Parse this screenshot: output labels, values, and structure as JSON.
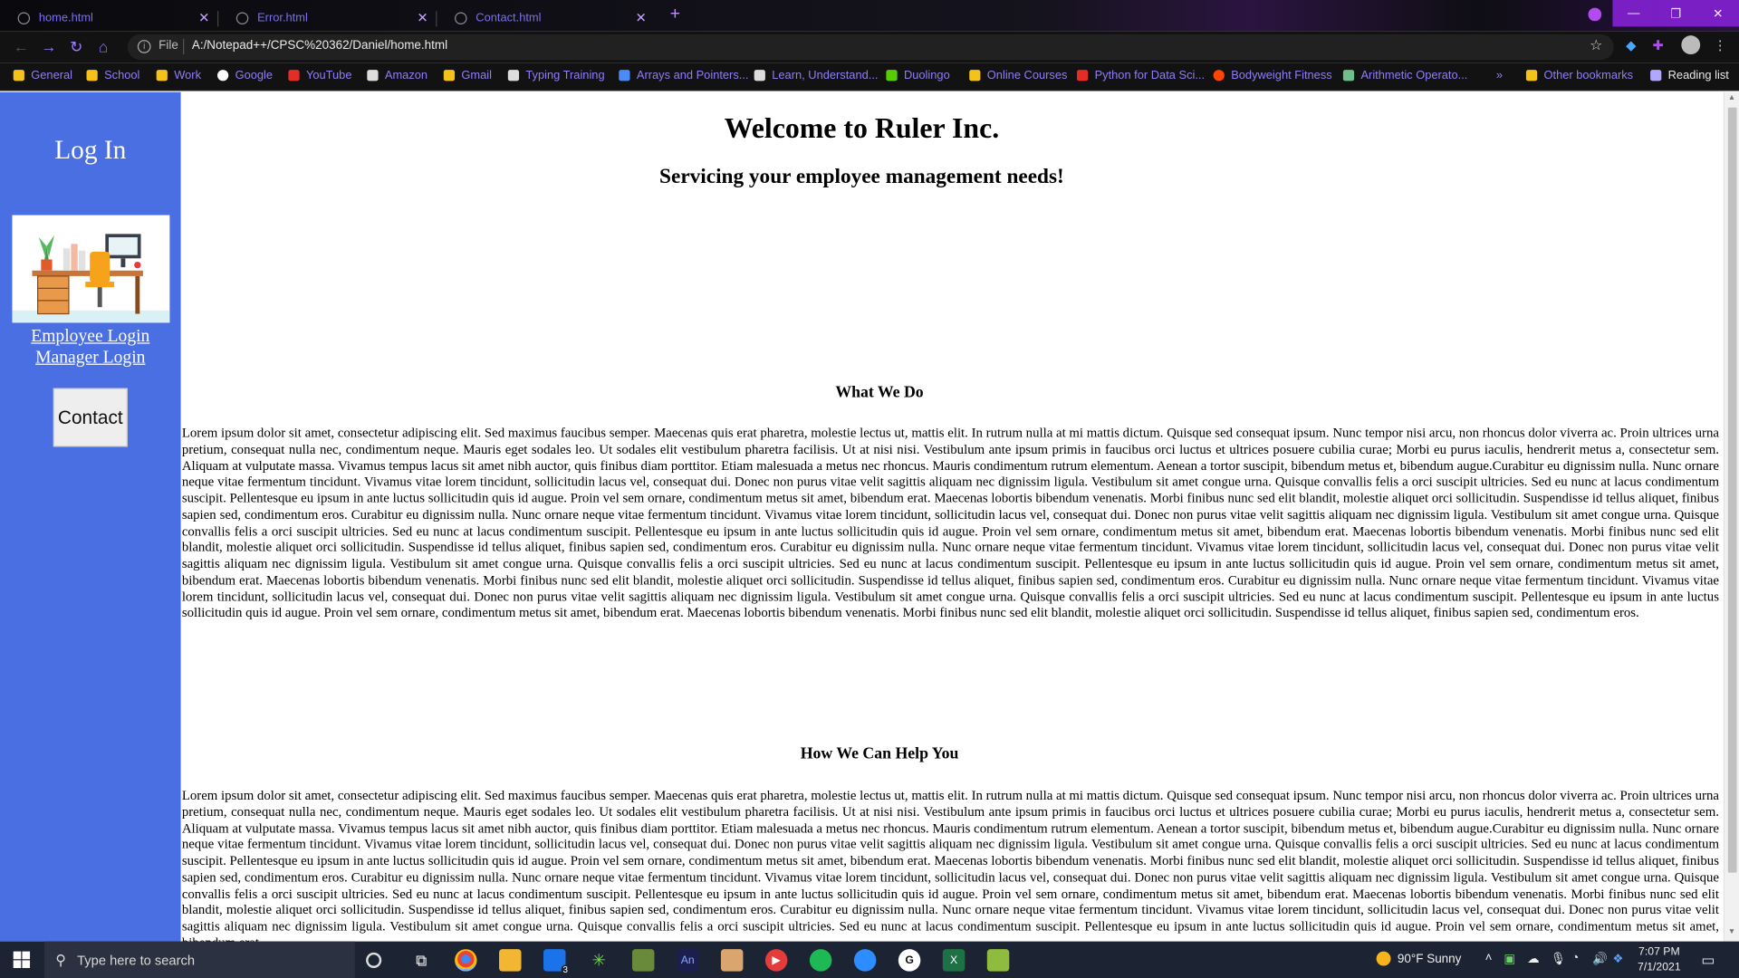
{
  "browser": {
    "tabs": [
      {
        "title": "home.html",
        "active": true
      },
      {
        "title": "Error.html",
        "active": false
      },
      {
        "title": "Contact.html",
        "active": false
      }
    ],
    "new_tab_icon": "+",
    "address": {
      "security_label": "File",
      "url": "A:/Notepad++/CPSC%20362/Daniel/home.html"
    },
    "bookmarks": [
      {
        "label": "General",
        "icon": "folder"
      },
      {
        "label": "School",
        "icon": "folder"
      },
      {
        "label": "Work",
        "icon": "folder"
      },
      {
        "label": "Google",
        "icon": "google"
      },
      {
        "label": "YouTube",
        "icon": "youtube"
      },
      {
        "label": "Amazon",
        "icon": "amazon"
      },
      {
        "label": "Gmail",
        "icon": "folder"
      },
      {
        "label": "Typing Training",
        "icon": "doc"
      },
      {
        "label": "Arrays and Pointers...",
        "icon": "c"
      },
      {
        "label": "Learn, Understand...",
        "icon": "grid"
      },
      {
        "label": "Duolingo",
        "icon": "duolingo"
      },
      {
        "label": "Online Courses",
        "icon": "folder"
      },
      {
        "label": "Python for Data Sci...",
        "icon": "udemy"
      },
      {
        "label": "Bodyweight Fitness",
        "icon": "reddit"
      },
      {
        "label": "Arithmetic Operato...",
        "icon": "site"
      }
    ],
    "more_bookmarks": "»",
    "other_bookmarks": "Other bookmarks",
    "reading_list": "Reading list"
  },
  "sidebar": {
    "title": "Log In",
    "employee_login": "Employee Login",
    "manager_login": "Manager Login",
    "contact_button": "Contact"
  },
  "main": {
    "heading": "Welcome to Ruler Inc.",
    "subheading": "Servicing your employee management needs!",
    "section1_title": "What We Do",
    "section1_text": "Lorem ipsum dolor sit amet, consectetur adipiscing elit. Sed maximus faucibus semper. Maecenas quis erat pharetra, molestie lectus ut, mattis elit. In rutrum nulla at mi mattis dictum. Quisque sed consequat ipsum. Nunc tempor nisi arcu, non rhoncus dolor viverra ac. Proin ultrices urna pretium, consequat nulla nec, condimentum neque. Mauris eget sodales leo. Ut sodales elit vestibulum pharetra facilisis. Ut at nisi nisi. Vestibulum ante ipsum primis in faucibus orci luctus et ultrices posuere cubilia curae; Morbi eu purus iaculis, hendrerit metus a, consectetur sem. Aliquam at vulputate massa. Vivamus tempus lacus sit amet nibh auctor, quis finibus diam porttitor. Etiam malesuada a metus nec rhoncus. Mauris condimentum rutrum elementum. Aenean a tortor suscipit, bibendum metus et, bibendum augue.Curabitur eu dignissim nulla. Nunc ornare neque vitae fermentum tincidunt. Vivamus vitae lorem tincidunt, sollicitudin lacus vel, consequat dui. Donec non purus vitae velit sagittis aliquam nec dignissim ligula. Vestibulum sit amet congue urna. Quisque convallis felis a orci suscipit ultricies. Sed eu nunc at lacus condimentum suscipit. Pellentesque eu ipsum in ante luctus sollicitudin quis id augue. Proin vel sem ornare, condimentum metus sit amet, bibendum erat. Maecenas lobortis bibendum venenatis. Morbi finibus nunc sed elit blandit, molestie aliquet orci sollicitudin. Suspendisse id tellus aliquet, finibus sapien sed, condimentum eros. Curabitur eu dignissim nulla. Nunc ornare neque vitae fermentum tincidunt. Vivamus vitae lorem tincidunt, sollicitudin lacus vel, consequat dui. Donec non purus vitae velit sagittis aliquam nec dignissim ligula. Vestibulum sit amet congue urna. Quisque convallis felis a orci suscipit ultricies. Sed eu nunc at lacus condimentum suscipit. Pellentesque eu ipsum in ante luctus sollicitudin quis id augue. Proin vel sem ornare, condimentum metus sit amet, bibendum erat. Maecenas lobortis bibendum venenatis. Morbi finibus nunc sed elit blandit, molestie aliquet orci sollicitudin. Suspendisse id tellus aliquet, finibus sapien sed, condimentum eros. Curabitur eu dignissim nulla. Nunc ornare neque vitae fermentum tincidunt. Vivamus vitae lorem tincidunt, sollicitudin lacus vel, consequat dui. Donec non purus vitae velit sagittis aliquam nec dignissim ligula. Vestibulum sit amet congue urna. Quisque convallis felis a orci suscipit ultricies. Sed eu nunc at lacus condimentum suscipit. Pellentesque eu ipsum in ante luctus sollicitudin quis id augue. Proin vel sem ornare, condimentum metus sit amet, bibendum erat. Maecenas lobortis bibendum venenatis. Morbi finibus nunc sed elit blandit, molestie aliquet orci sollicitudin. Suspendisse id tellus aliquet, finibus sapien sed, condimentum eros. Curabitur eu dignissim nulla. Nunc ornare neque vitae fermentum tincidunt. Vivamus vitae lorem tincidunt, sollicitudin lacus vel, consequat dui. Donec non purus vitae velit sagittis aliquam nec dignissim ligula. Vestibulum sit amet congue urna. Quisque convallis felis a orci suscipit ultricies. Sed eu nunc at lacus condimentum suscipit. Pellentesque eu ipsum in ante luctus sollicitudin quis id augue. Proin vel sem ornare, condimentum metus sit amet, bibendum erat. Maecenas lobortis bibendum venenatis. Morbi finibus nunc sed elit blandit, molestie aliquet orci sollicitudin. Suspendisse id tellus aliquet, finibus sapien sed, condimentum eros.",
    "section2_title": "How We Can Help You",
    "section2_text": "Lorem ipsum dolor sit amet, consectetur adipiscing elit. Sed maximus faucibus semper. Maecenas quis erat pharetra, molestie lectus ut, mattis elit. In rutrum nulla at mi mattis dictum. Quisque sed consequat ipsum. Nunc tempor nisi arcu, non rhoncus dolor viverra ac. Proin ultrices urna pretium, consequat nulla nec, condimentum neque. Mauris eget sodales leo. Ut sodales elit vestibulum pharetra facilisis. Ut at nisi nisi. Vestibulum ante ipsum primis in faucibus orci luctus et ultrices posuere cubilia curae; Morbi eu purus iaculis, hendrerit metus a, consectetur sem. Aliquam at vulputate massa. Vivamus tempus lacus sit amet nibh auctor, quis finibus diam porttitor. Etiam malesuada a metus nec rhoncus. Mauris condimentum rutrum elementum. Aenean a tortor suscipit, bibendum metus et, bibendum augue.Curabitur eu dignissim nulla. Nunc ornare neque vitae fermentum tincidunt. Vivamus vitae lorem tincidunt, sollicitudin lacus vel, consequat dui. Donec non purus vitae velit sagittis aliquam nec dignissim ligula. Vestibulum sit amet congue urna. Quisque convallis felis a orci suscipit ultricies. Sed eu nunc at lacus condimentum suscipit. Pellentesque eu ipsum in ante luctus sollicitudin quis id augue. Proin vel sem ornare, condimentum metus sit amet, bibendum erat. Maecenas lobortis bibendum venenatis. Morbi finibus nunc sed elit blandit, molestie aliquet orci sollicitudin. Suspendisse id tellus aliquet, finibus sapien sed, condimentum eros. Curabitur eu dignissim nulla. Nunc ornare neque vitae fermentum tincidunt. Vivamus vitae lorem tincidunt, sollicitudin lacus vel, consequat dui. Donec non purus vitae velit sagittis aliquam nec dignissim ligula. Vestibulum sit amet congue urna. Quisque convallis felis a orci suscipit ultricies. Sed eu nunc at lacus condimentum suscipit. Pellentesque eu ipsum in ante luctus sollicitudin quis id augue. Proin vel sem ornare, condimentum metus sit amet, bibendum erat. Maecenas lobortis bibendum venenatis. Morbi finibus nunc sed elit blandit, molestie aliquet orci sollicitudin. Suspendisse id tellus aliquet, finibus sapien sed, condimentum eros. Curabitur eu dignissim nulla. Nunc ornare neque vitae fermentum tincidunt. Vivamus vitae lorem tincidunt, sollicitudin lacus vel, consequat dui. Donec non purus vitae velit sagittis aliquam nec dignissim ligula. Vestibulum sit amet congue urna. Quisque convallis felis a orci suscipit ultricies. Sed eu nunc at lacus condimentum suscipit. Pellentesque eu ipsum in ante luctus sollicitudin quis id augue. Proin vel sem ornare, condimentum metus sit amet, bibendum erat."
  },
  "taskbar": {
    "search_placeholder": "Type here to search",
    "mail_badge": "3",
    "weather": "90°F  Sunny",
    "time": "7:07 PM",
    "date": "7/1/2021"
  },
  "colors": {
    "sidebar": "#4a6fe3",
    "accent_tab_text": "#7b6ff0",
    "taskbar": "#1c2333"
  }
}
